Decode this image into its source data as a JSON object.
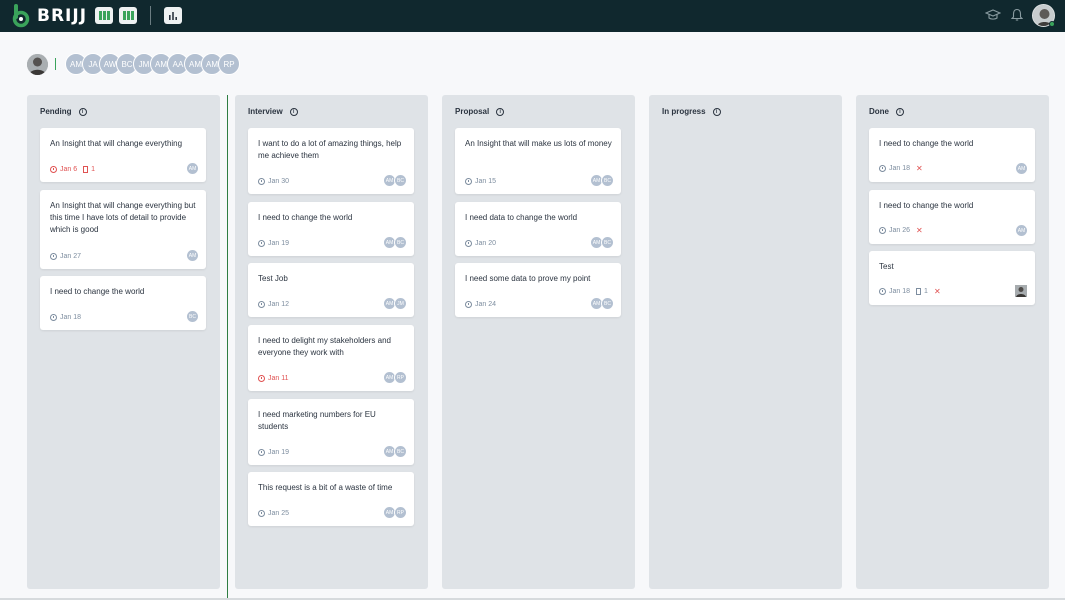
{
  "brand": {
    "name": "BRIJJ",
    "color": "#3aa35b"
  },
  "topbar": {
    "bg": "#10282e",
    "views": [
      "kanban-board-icon",
      "columns-icon",
      "bar-chart-icon"
    ],
    "right_icons": [
      "graduation-cap-icon",
      "bell-icon"
    ]
  },
  "members": [
    "AM",
    "JA",
    "AW",
    "BC",
    "JM",
    "AM",
    "AA",
    "AM",
    "AM",
    "RP"
  ],
  "columns": [
    {
      "name": "Pending",
      "cards": [
        {
          "title": "An Insight that will change everything",
          "date": "Jan 6",
          "overdue": true,
          "attachments": "1",
          "assignees": [
            "AM"
          ]
        },
        {
          "title": "An Insight that will change everything but this time I have lots of detail to provide which is good",
          "date": "Jan 27",
          "overdue": false,
          "assignees": [
            "AM"
          ]
        },
        {
          "title": "I need to change the world",
          "date": "Jan 18",
          "overdue": false,
          "assignees": [
            "BC"
          ]
        }
      ]
    },
    {
      "name": "Interview",
      "cards": [
        {
          "title": "I want to do a lot of amazing things, help me achieve them",
          "date": "Jan 30",
          "overdue": false,
          "assignees": [
            "AM",
            "BC"
          ]
        },
        {
          "title": "I need to change the world",
          "date": "Jan 19",
          "overdue": false,
          "assignees": [
            "AM",
            "BC"
          ]
        },
        {
          "title": "Test Job",
          "date": "Jan 12",
          "overdue": false,
          "assignees": [
            "AM",
            "JM"
          ]
        },
        {
          "title": "I need to delight my stakeholders and everyone they work with",
          "date": "Jan 11",
          "overdue": true,
          "assignees": [
            "AM",
            "RP"
          ]
        },
        {
          "title": "I need marketing numbers for EU students",
          "date": "Jan 19",
          "overdue": false,
          "assignees": [
            "AM",
            "BC"
          ]
        },
        {
          "title": "This request is a bit of a waste of time",
          "date": "Jan 25",
          "overdue": false,
          "assignees": [
            "AM",
            "RP"
          ]
        }
      ]
    },
    {
      "name": "Proposal",
      "cards": [
        {
          "title": "An Insight that will make us lots of money",
          "date": "Jan 15",
          "overdue": false,
          "assignees": [
            "AM",
            "BC"
          ]
        },
        {
          "title": "I need data to change the world",
          "date": "Jan 20",
          "overdue": false,
          "assignees": [
            "AM",
            "BC"
          ]
        },
        {
          "title": "I need some data to prove my point",
          "date": "Jan 24",
          "overdue": false,
          "assignees": [
            "AM",
            "BC"
          ]
        }
      ]
    },
    {
      "name": "In progress",
      "cards": []
    },
    {
      "name": "Done",
      "cards": [
        {
          "title": "I need to change the world",
          "date": "Jan 18",
          "overdue": false,
          "rejected": true,
          "assignees": [
            "AM"
          ]
        },
        {
          "title": "I need to change the world",
          "date": "Jan 26",
          "overdue": false,
          "rejected": true,
          "assignees": [
            "AM"
          ]
        },
        {
          "title": "Test",
          "date": "Jan 18",
          "overdue": false,
          "attachments": "1",
          "rejected": true,
          "assignees": [
            "photo"
          ]
        }
      ]
    }
  ]
}
